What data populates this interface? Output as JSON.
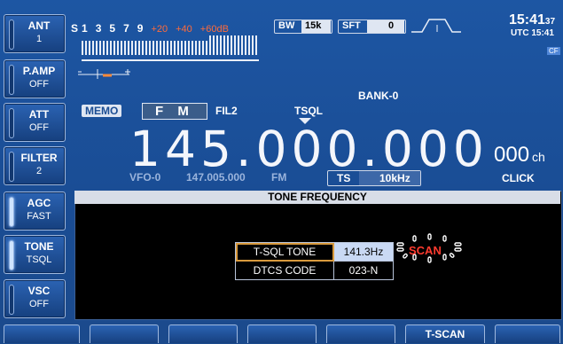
{
  "left_keys": [
    {
      "label": "ANT",
      "value": "1",
      "indicator_on": false
    },
    {
      "label": "P.AMP",
      "value": "OFF",
      "indicator_on": false
    },
    {
      "label": "ATT",
      "value": "OFF",
      "indicator_on": false
    },
    {
      "label": "FILTER",
      "value": "2",
      "indicator_on": false
    },
    {
      "label": "AGC",
      "value": "FAST",
      "indicator_on": true
    },
    {
      "label": "TONE",
      "value": "TSQL",
      "indicator_on": true
    },
    {
      "label": "VSC",
      "value": "OFF",
      "indicator_on": false
    }
  ],
  "meter": {
    "s_label": "S",
    "scale": [
      "1",
      "3",
      "5",
      "7",
      "9"
    ],
    "scale_over": [
      "+20",
      "+40",
      "+60dB"
    ]
  },
  "bw": {
    "label": "BW",
    "value": "15k"
  },
  "sft": {
    "label": "SFT",
    "value": "0"
  },
  "clock": {
    "time": "15:41",
    "seconds": "37",
    "utc": "UTC 15:41",
    "cf": "CF"
  },
  "tags": {
    "memo": "MEMO",
    "mode": "F M",
    "fil": "FIL2",
    "tsql": "TSQL",
    "bank": "BANK-0"
  },
  "frequency": {
    "main": "145.000.000",
    "channel": "000",
    "channel_unit": "ch"
  },
  "sub": {
    "vfo": "VFO-0",
    "freq": "147.005.000",
    "mode": "FM",
    "ts_label": "TS",
    "ts_value": "10kHz",
    "click": "CLICK"
  },
  "panel": {
    "title": "TONE FREQUENCY",
    "rows": [
      {
        "label": "T-SQL TONE",
        "value": "141.3Hz"
      },
      {
        "label": "DTCS CODE",
        "value": "023-N"
      }
    ],
    "scan": "SCAN"
  },
  "bottom_keys": [
    "",
    "",
    "",
    "",
    "",
    "T-SCAN",
    ""
  ],
  "colors": {
    "background": "#1b4d93",
    "accent_red": "#ff3b2f",
    "highlight": "#c9d9f4",
    "selection": "#d99a3d"
  }
}
